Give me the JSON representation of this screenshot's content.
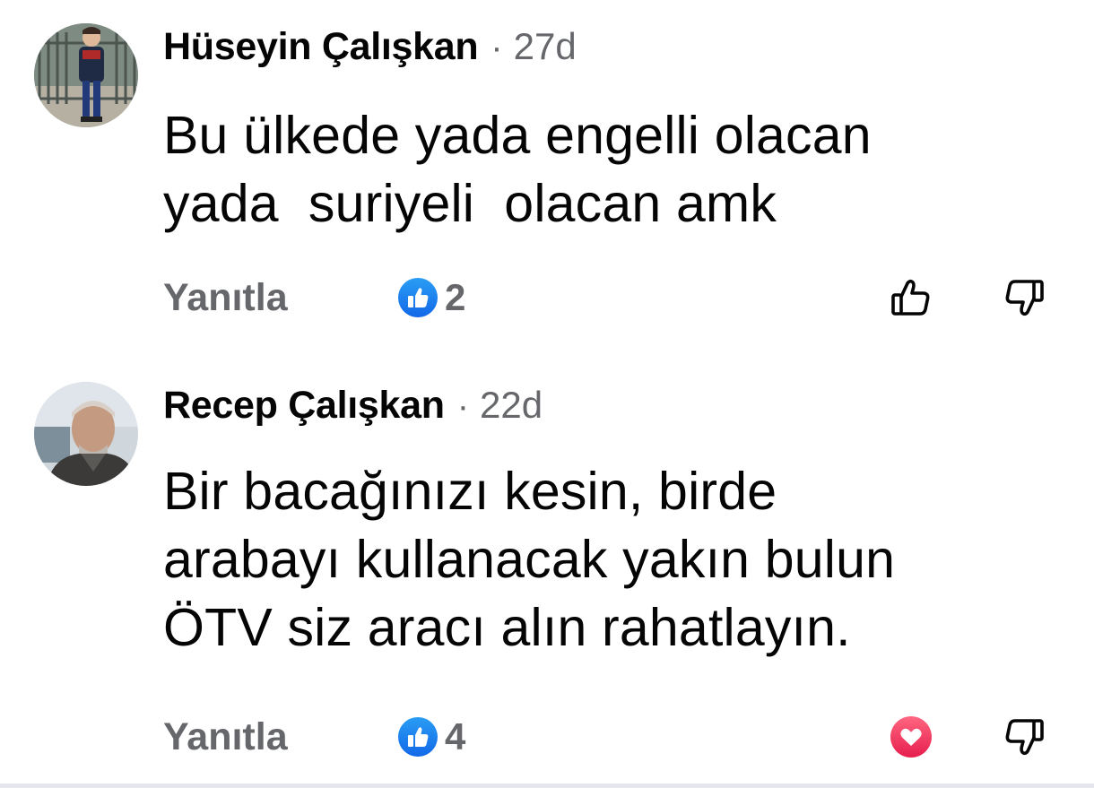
{
  "comments": [
    {
      "author": "Hüseyin Çalışkan",
      "separator": "·",
      "time": "27d",
      "text_lines": [
        "Bu ülkede yada engelli olacan",
        "yada  suriyeli  olacan amk"
      ],
      "reply_label": "Yanıtla",
      "reaction_icon": "like-reaction-icon",
      "reaction_count": "2",
      "user_vote": "none",
      "upvote_icon": "thumbs-up-outline-icon",
      "downvote_icon": "thumbs-down-outline-icon"
    },
    {
      "author": "Recep Çalışkan",
      "separator": "·",
      "time": "22d",
      "text_lines": [
        "Bir bacağınızı kesin, birde",
        "arabayı kullanacak yakın bulun",
        "ÖTV siz aracı alın rahatlayın."
      ],
      "reply_label": "Yanıtla",
      "reaction_icon": "like-reaction-icon",
      "reaction_count": "4",
      "user_vote": "love",
      "upvote_icon": "love-reaction-icon",
      "downvote_icon": "thumbs-down-outline-icon"
    }
  ],
  "colors": {
    "text": "#050505",
    "secondary": "#65676b",
    "like_blue": "#1877f2",
    "love_red": "#f33e58",
    "divider": "#e4e6eb"
  }
}
